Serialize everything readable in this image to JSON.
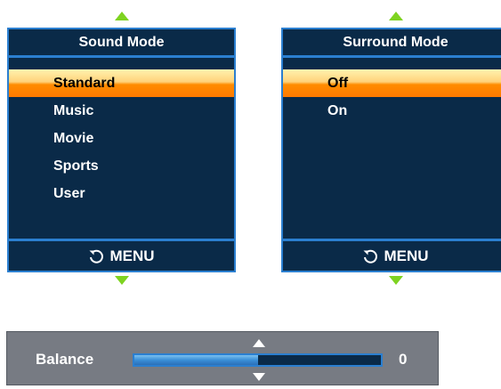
{
  "sound_mode": {
    "title": "Sound Mode",
    "items": [
      {
        "label": "Standard",
        "selected": true
      },
      {
        "label": "Music",
        "selected": false
      },
      {
        "label": "Movie",
        "selected": false
      },
      {
        "label": "Sports",
        "selected": false
      },
      {
        "label": "User",
        "selected": false
      }
    ],
    "footer_label": "MENU"
  },
  "surround_mode": {
    "title": "Surround Mode",
    "items": [
      {
        "label": "Off",
        "selected": true
      },
      {
        "label": "On",
        "selected": false
      }
    ],
    "footer_label": "MENU"
  },
  "balance": {
    "label": "Balance",
    "value": "0",
    "level_fraction": 0.5
  },
  "colors": {
    "panel_bg": "#0a2a48",
    "panel_border": "#2b7fd0",
    "highlight": "#ff8c00",
    "arrow_green": "#7ed321",
    "balance_bg": "#777b83"
  },
  "icons": {
    "scroll_up": "triangle-up-icon",
    "scroll_down": "triangle-down-icon",
    "back": "return-arrow-icon"
  }
}
